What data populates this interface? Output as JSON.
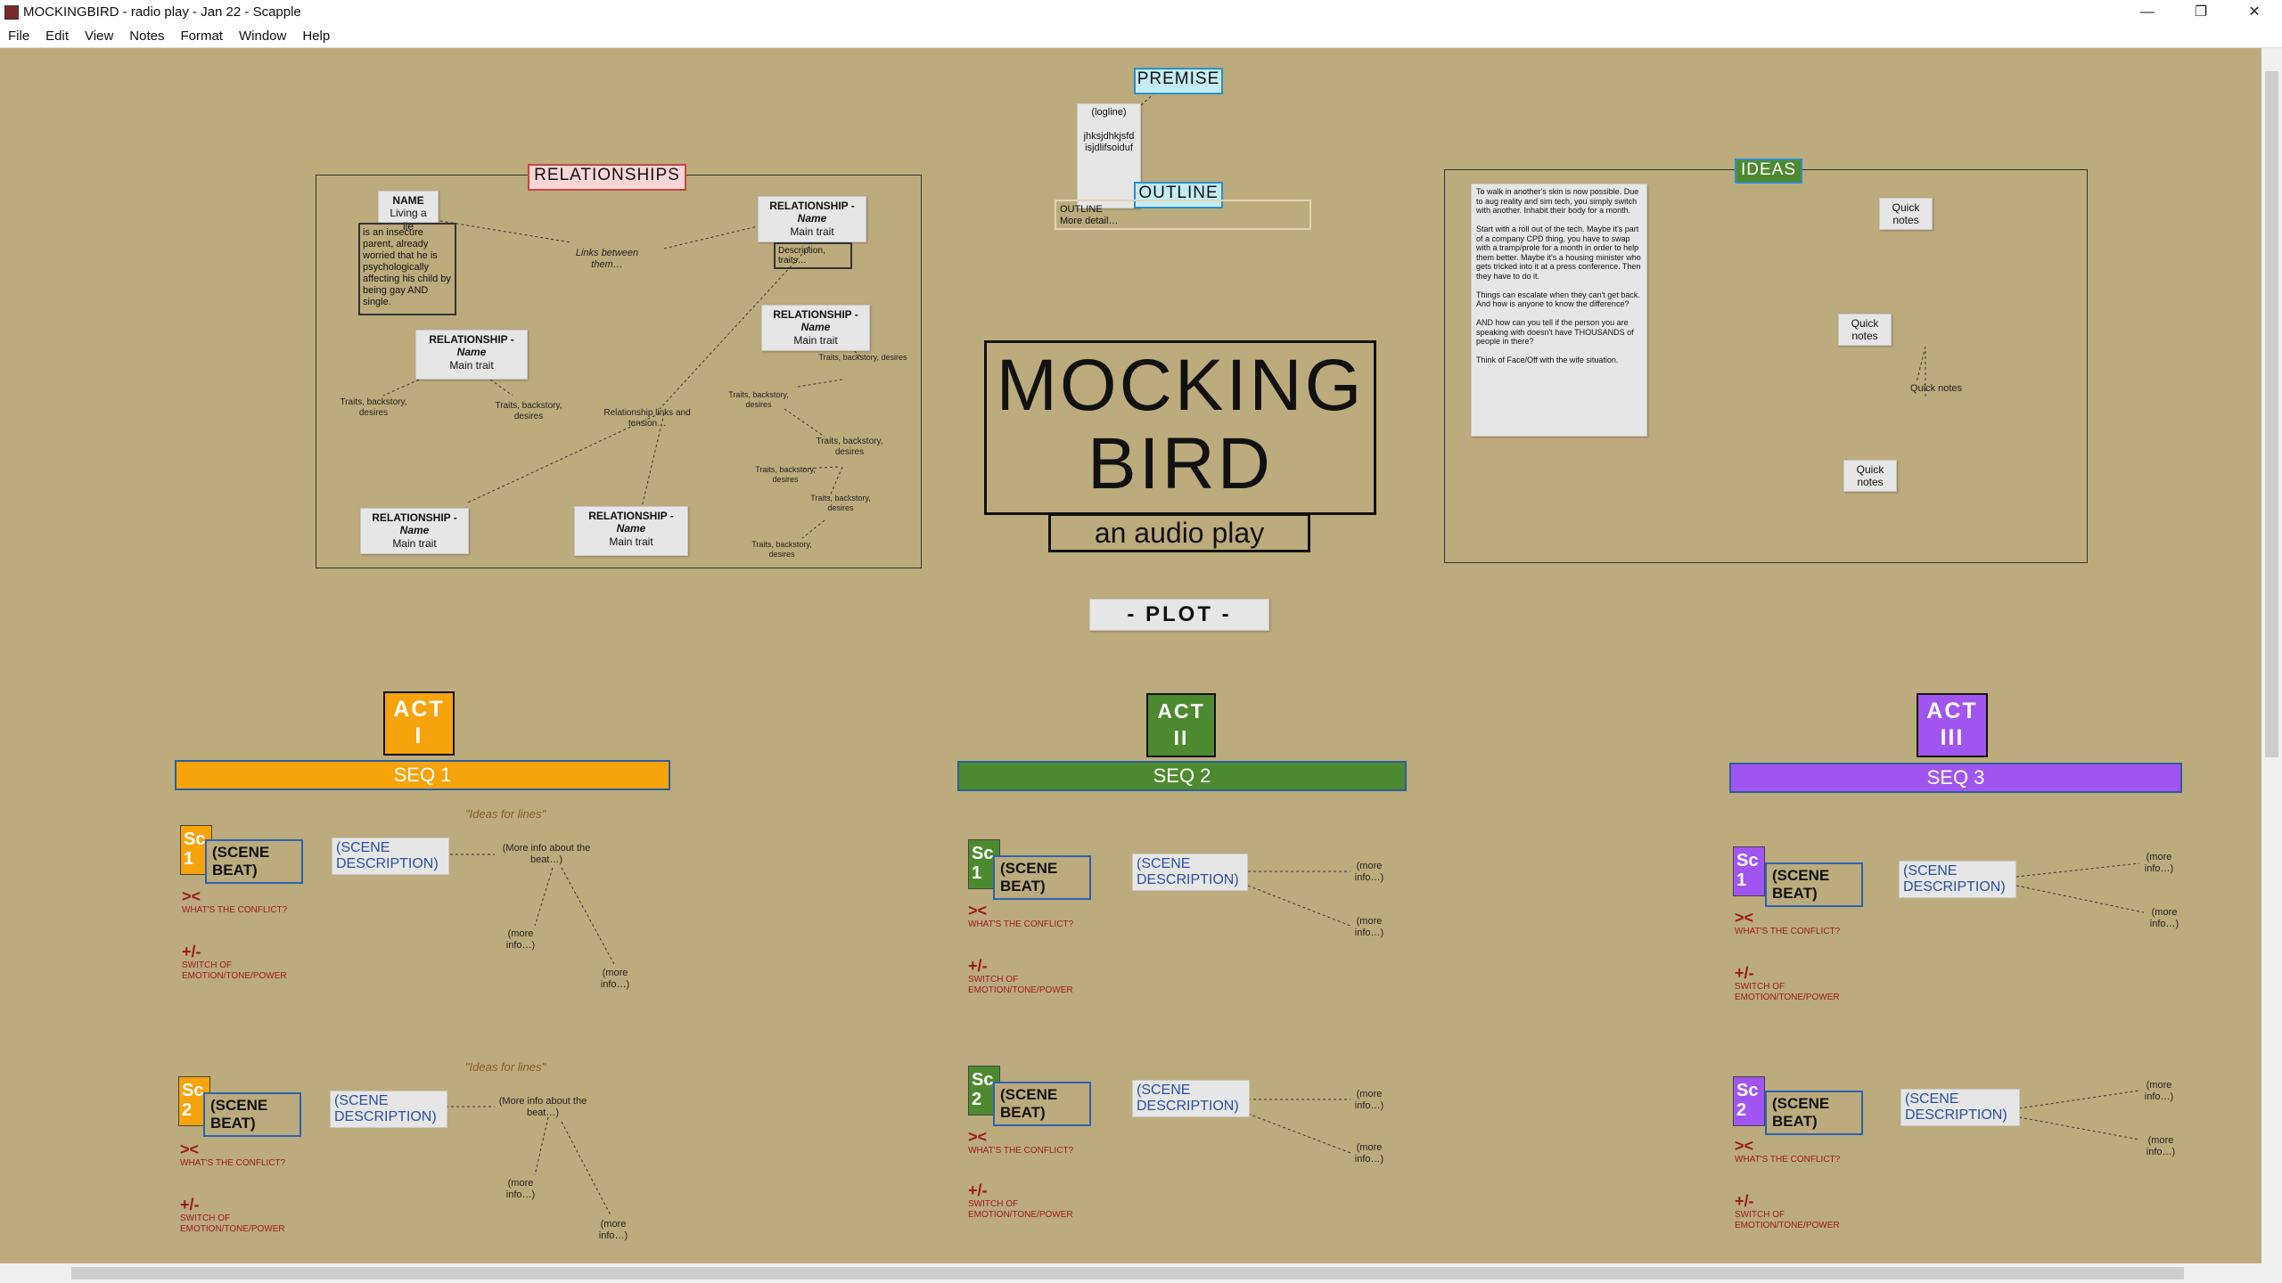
{
  "window": {
    "title": "MOCKINGBIRD - radio play - Jan 22 - Scapple",
    "controls": [
      "—",
      "❐",
      "✕"
    ]
  },
  "menu": [
    "File",
    "Edit",
    "View",
    "Notes",
    "Format",
    "Window",
    "Help"
  ],
  "premise": {
    "header": "PREMISE",
    "logline": "(logline)",
    "text": "jhksjdhkjsfd isjdlifsoiduf"
  },
  "outline": {
    "header": "OUTLINE",
    "note_title": "OUTLINE",
    "note_text": "More detail…"
  },
  "relationships": {
    "header": "RELATIONSHIPS",
    "name_note": {
      "title": "NAME",
      "sub": "Living a lie"
    },
    "lie_note": "is an insecure parent, already worried that he is psychologically affecting his child by being gay AND single.",
    "links_between": "Links between them…",
    "rel_title": "RELATIONSHIP -",
    "rel_name": "Name",
    "rel_trait": "Main trait",
    "description": "Description, traits…",
    "traits": "Traits, backstory, desires",
    "links_tension": "Relationship links and tension…"
  },
  "title_block": {
    "line1": "MOCKING",
    "line2": "BIRD",
    "subtitle": "an audio play"
  },
  "ideas": {
    "header": "IDEAS",
    "text": "To walk in another's skin is now possible. Due to aug reality and sim tech, you simply switch with another. Inhabit their body for a month.\n\nStart with a roll out of the tech. Maybe it's part of a company CPD thing, you have to swap with a tramp/prole for a month in order to help them better. Maybe it's a housing minister who gets tricked into it at a press conference. Then they have to do it.\n\nThings can escalate when they can't get back. And how is anyone to know the difference?\n\nAND how can you tell if the person you are speaking with doesn't have THOUSANDS of people in there?\n\nThink of Face/Off with the wife situation.",
    "quick": "Quick notes"
  },
  "plot": {
    "header": "- PLOT -"
  },
  "acts": [
    {
      "label": "ACT",
      "numeral": "I",
      "seq": "SEQ 1",
      "color": "#f7a30c"
    },
    {
      "label": "ACT",
      "numeral": "II",
      "seq": "SEQ 2",
      "color": "#4d8a2f"
    },
    {
      "label": "ACT",
      "numeral": "III",
      "seq": "SEQ 3",
      "color": "#a155f0"
    }
  ],
  "scene": {
    "sc": "Sc",
    "beat": "(SCENE BEAT)",
    "desc": "(SCENE DESCRIPTION)",
    "ideas_for_lines": "\"Ideas for lines\"",
    "more_about_beat": "(More info about the beat…)",
    "more_info": "(more info…)",
    "conflict_symbol": "><",
    "conflict_label": "WHAT'S THE CONFLICT?",
    "switch_symbol": "+/-",
    "switch_label": "SWITCH OF EMOTION/TONE/POWER"
  },
  "colors": {
    "canvas": "#bcab7c",
    "header_border": "#2d8fc9",
    "relationships_header": "#f8d6d6",
    "premise_header": "#c4ecf3",
    "ideas_header": "#4d8a2f",
    "conflict_red": "#9a1a1a",
    "desc_blue": "#2a4fa0"
  }
}
